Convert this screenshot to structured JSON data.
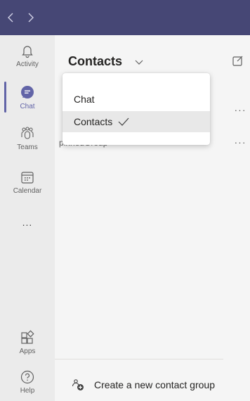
{
  "titlebar": {
    "back_icon": "chevron-left-icon",
    "forward_icon": "chevron-right-icon"
  },
  "rail": {
    "items": [
      {
        "label": "Activity",
        "icon": "bell-icon"
      },
      {
        "label": "Chat",
        "icon": "chat-icon",
        "active": true
      },
      {
        "label": "Teams",
        "icon": "teams-icon"
      },
      {
        "label": "Calendar",
        "icon": "calendar-icon"
      },
      {
        "label": "...",
        "icon": "more-icon"
      },
      {
        "label": "Apps",
        "icon": "apps-icon"
      },
      {
        "label": "Help",
        "icon": "help-icon"
      }
    ]
  },
  "main": {
    "title": "Contacts",
    "rows": [
      {
        "text": "",
        "more": "···"
      },
      {
        "text": "pinnedGroup",
        "more": "···"
      }
    ],
    "footer_action": "Create a new contact group"
  },
  "dropdown": {
    "items": [
      {
        "label": "Chat",
        "selected": false
      },
      {
        "label": "Contacts",
        "selected": true
      }
    ]
  },
  "colors": {
    "titlebar": "#464775",
    "accent": "#6264a7",
    "rail": "#ebebeb"
  }
}
